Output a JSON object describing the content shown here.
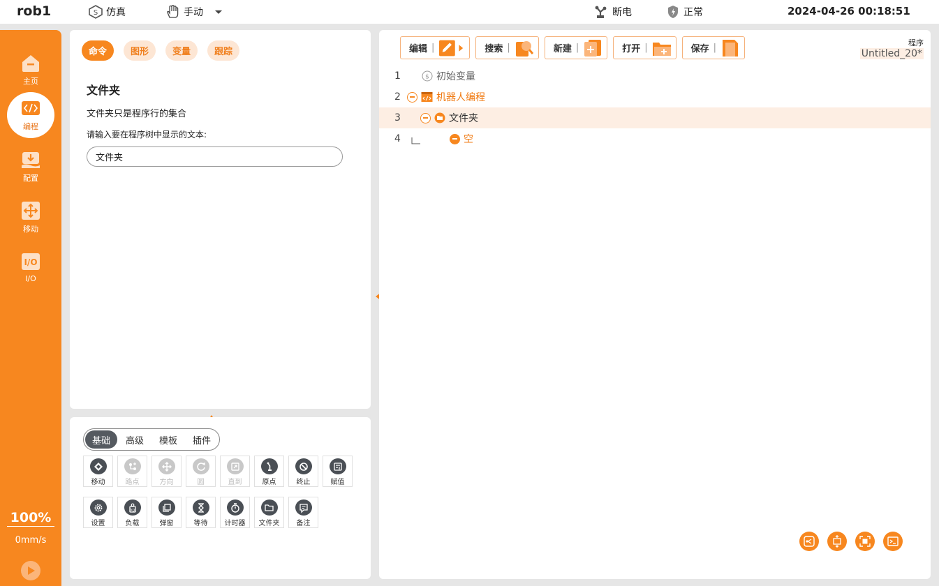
{
  "topbar": {
    "robot_name": "rob1",
    "sim_label": "仿真",
    "mode_label": "手动",
    "power_label": "断电",
    "status_label": "正常",
    "datetime": "2024-04-26 00:18:51"
  },
  "sidebar": {
    "items": [
      {
        "label": "主页",
        "icon": "home-icon"
      },
      {
        "label": "编程",
        "icon": "code-icon"
      },
      {
        "label": "配置",
        "icon": "config-icon"
      },
      {
        "label": "移动",
        "icon": "move-icon"
      },
      {
        "label": "I/O",
        "icon": "io-icon"
      }
    ],
    "active": "编程",
    "speed_percent": "100%",
    "speed_value": "0mm/s",
    "bottom_marks": [
      "?",
      "?",
      "?",
      "?"
    ]
  },
  "left_top": {
    "tabs": [
      {
        "label": "命令",
        "active": true
      },
      {
        "label": "图形",
        "active": false
      },
      {
        "label": "变量",
        "active": false
      },
      {
        "label": "跟踪",
        "active": false
      }
    ],
    "title": "文件夹",
    "description": "文件夹只是程序行的集合",
    "prompt": "请输入要在程序树中显示的文本:",
    "input_value": "文件夹"
  },
  "left_bottom": {
    "segments": [
      {
        "label": "基础",
        "active": true
      },
      {
        "label": "高级",
        "active": false
      },
      {
        "label": "模板",
        "active": false
      },
      {
        "label": "插件",
        "active": false
      }
    ],
    "commands": [
      {
        "label": "移动",
        "icon": "move-cmd-icon",
        "enabled": true
      },
      {
        "label": "路点",
        "icon": "waypoint-icon",
        "enabled": false
      },
      {
        "label": "方向",
        "icon": "direction-icon",
        "enabled": false
      },
      {
        "label": "圆",
        "icon": "circle-icon",
        "enabled": false
      },
      {
        "label": "直到",
        "icon": "until-icon",
        "enabled": false
      },
      {
        "label": "原点",
        "icon": "origin-icon",
        "enabled": true
      },
      {
        "label": "终止",
        "icon": "stop-icon",
        "enabled": true
      },
      {
        "label": "赋值",
        "icon": "assign-icon",
        "enabled": true
      },
      {
        "label": "设置",
        "icon": "settings-icon",
        "enabled": true
      },
      {
        "label": "负载",
        "icon": "payload-icon",
        "enabled": true
      },
      {
        "label": "弹窗",
        "icon": "popup-icon",
        "enabled": true
      },
      {
        "label": "等待",
        "icon": "wait-icon",
        "enabled": true
      },
      {
        "label": "计时器",
        "icon": "timer-icon",
        "enabled": true
      },
      {
        "label": "文件夹",
        "icon": "folder-icon",
        "enabled": true
      },
      {
        "label": "备注",
        "icon": "comment-icon",
        "enabled": true
      }
    ]
  },
  "right": {
    "toolbar": [
      {
        "label": "编辑",
        "sep": "|",
        "icon": "edit-icon"
      },
      {
        "label": "搜索",
        "sep": "|",
        "icon": "search-icon"
      },
      {
        "label": "新建",
        "sep": "|",
        "icon": "new-icon"
      },
      {
        "label": "打开",
        "sep": "|",
        "icon": "open-icon"
      },
      {
        "label": "保存",
        "sep": "|",
        "icon": "save-icon"
      }
    ],
    "program_label": "程序",
    "program_name": "Untitled_20*",
    "tree": [
      {
        "line": "1",
        "text": "初始变量"
      },
      {
        "line": "2",
        "text": "机器人编程"
      },
      {
        "line": "3",
        "text": "文件夹"
      },
      {
        "line": "4",
        "text": "空"
      }
    ],
    "colors": {
      "accent": "#f7871f",
      "selected_row": "#fdeee3"
    }
  }
}
